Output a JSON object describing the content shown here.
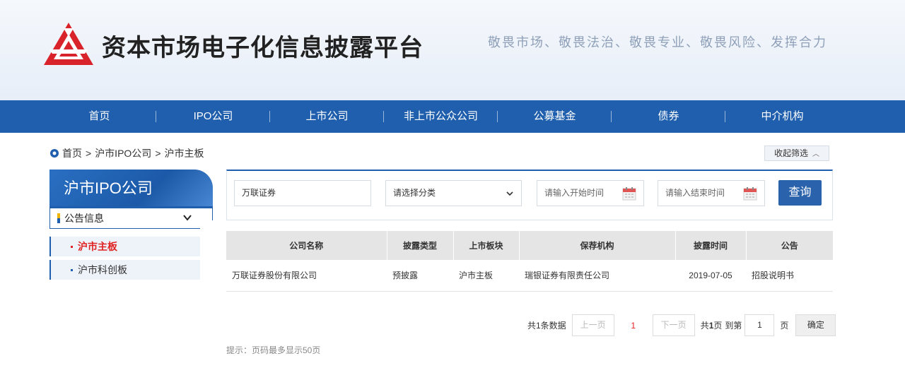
{
  "header": {
    "site_title": "资本市场电子化信息披露平台",
    "slogan": "敬畏市场、敬畏法治、敬畏专业、敬畏风险、发挥合力",
    "logo_icon": "triangle-logo-icon",
    "brand_color": "#d8232a"
  },
  "nav": {
    "items": [
      {
        "label": "首页"
      },
      {
        "label": "IPO公司"
      },
      {
        "label": "上市公司"
      },
      {
        "label": "非上市公众公司"
      },
      {
        "label": "公募基金"
      },
      {
        "label": "债券"
      },
      {
        "label": "中介机构"
      }
    ],
    "bg_color": "#1f5fad"
  },
  "breadcrumb": {
    "icon": "location-pin-icon",
    "items": [
      "首页",
      "沪市IPO公司",
      "沪市主板"
    ],
    "separator": ">"
  },
  "collapse_filter": {
    "label": "收起筛选",
    "icon": "chevron-up-icon"
  },
  "sidebar": {
    "title": "沪市IPO公司",
    "group_label": "公告信息",
    "items": [
      {
        "label": "沪市主板",
        "active": true
      },
      {
        "label": "沪市科创板",
        "active": false
      }
    ],
    "active_color": "#e02222"
  },
  "filters": {
    "company_value": "万联证券",
    "category_value": "请选择分类",
    "start_placeholder": "请输入开始时间",
    "end_placeholder": "请输入结束时间",
    "query_label": "查询",
    "calendar_icon": "calendar-icon"
  },
  "table": {
    "columns": [
      "公司名称",
      "披露类型",
      "上市板块",
      "保荐机构",
      "披露时间",
      "公告"
    ],
    "rows": [
      [
        "万联证券股份有限公司",
        "预披露",
        "沪市主板",
        "瑞银证券有限责任公司",
        "2019-07-05",
        "招股说明书"
      ]
    ]
  },
  "pagination": {
    "total_text": "共1条数据",
    "prev_label": "上一页",
    "current_page": "1",
    "next_label": "下一页",
    "pages_prefix": "共",
    "pages_count": "1",
    "pages_suffix": "页",
    "goto_label": "到第",
    "goto_value": "1",
    "goto_suffix": "页",
    "confirm_label": "确定"
  },
  "hint": "提示：页码最多显示50页"
}
